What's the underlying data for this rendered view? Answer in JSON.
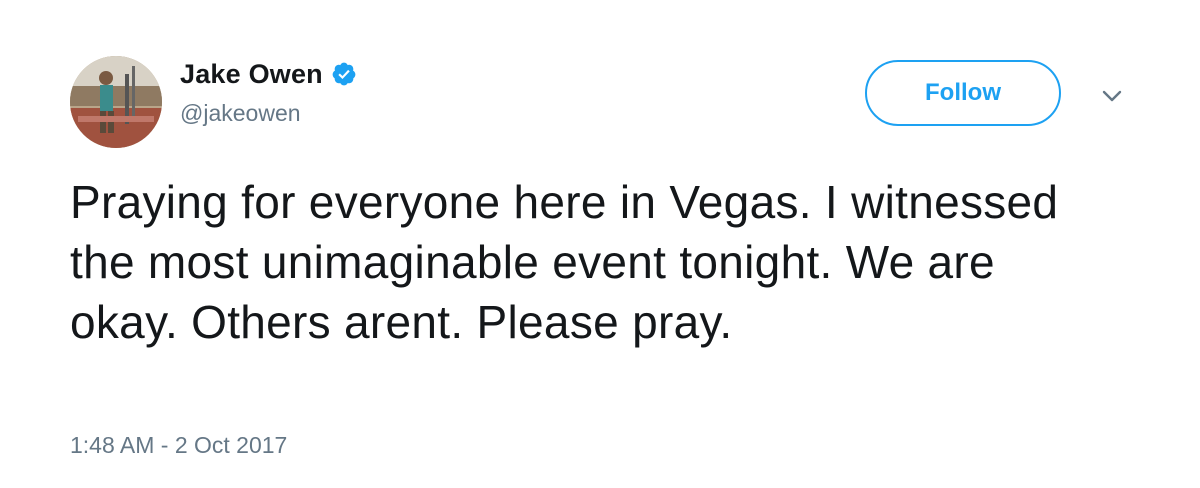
{
  "user": {
    "display_name": "Jake Owen",
    "handle": "@jakeowen",
    "verified": true
  },
  "follow_button": {
    "label": "Follow"
  },
  "tweet": {
    "text": "Praying for everyone here in Vegas. I witnessed the most unimaginable event tonight. We are okay. Others arent. Please pray.",
    "timestamp": "1:48 AM - 2 Oct 2017"
  },
  "icons": {
    "verified": "verified-badge-icon",
    "menu": "chevron-down-icon"
  },
  "colors": {
    "accent": "#1da1f2",
    "text": "#14171a",
    "muted": "#657786"
  }
}
